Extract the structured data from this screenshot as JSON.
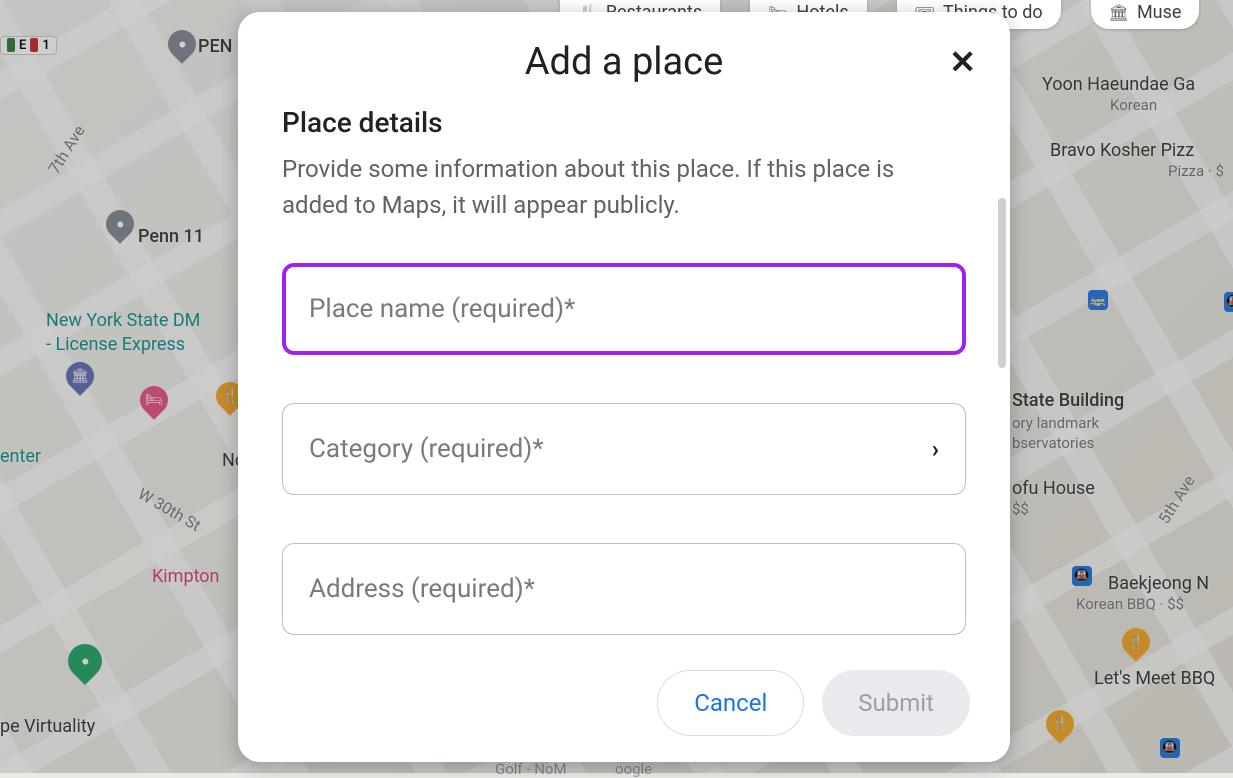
{
  "chips": {
    "restaurants": "Restaurants",
    "hotels": "Hotels",
    "things": "Things to do",
    "museums": "Muse"
  },
  "map_labels": {
    "penn_building": "PEN",
    "penn11": "Penn 11",
    "dmv": "New York State DM",
    "dmv2": "- License Express",
    "no": "No",
    "kimpton": "Kimpton",
    "virtuality": "pe Virtuality",
    "golf": "Golf - NoM",
    "ogle": "oogle",
    "center": "enter",
    "esb": "State Building",
    "esb2": "ory landmark",
    "esb3": "bservatories",
    "tofu": "ofu House",
    "tofu_price": "$$",
    "bravo": "Bravo Kosher Pizz",
    "bravo_sub": "Pizza · $",
    "yoon": "Yoon Haeundae Ga",
    "yoon_sub": "Korean",
    "baekjeong": "Baekjeong N",
    "baekjeong_sub": "Korean BBQ · $$",
    "lets": "Let's Meet BBQ",
    "seventh": "7th Ave",
    "fifth": "5th Ave",
    "w30": "W 30th St"
  },
  "route": {
    "e": "E",
    "one": "1"
  },
  "dialog": {
    "title": "Add a place",
    "section_title": "Place details",
    "section_desc": "Provide some information about this place. If this place is added to Maps, it will appear publicly.",
    "place_name_placeholder": "Place name (required)*",
    "category_placeholder": "Category (required)*",
    "address_placeholder": "Address (required)*",
    "cancel": "Cancel",
    "submit": "Submit"
  }
}
